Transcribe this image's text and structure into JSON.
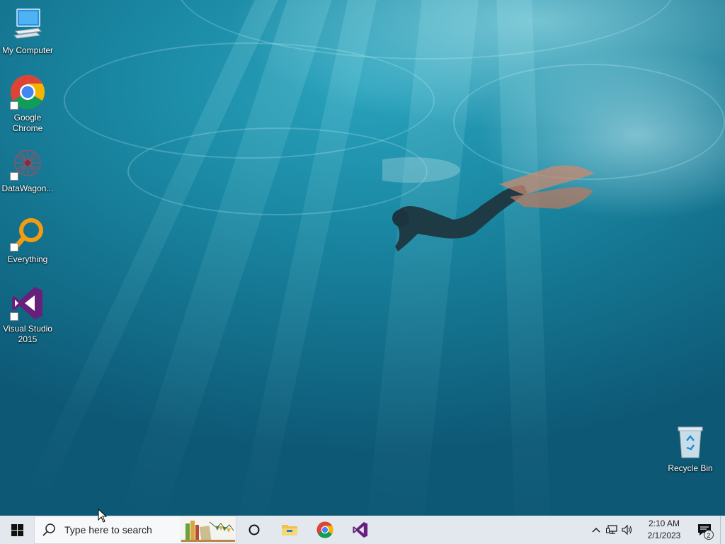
{
  "desktop": {
    "icons": [
      {
        "label": "My Computer"
      },
      {
        "label": "Google Chrome"
      },
      {
        "label": "DataWagon..."
      },
      {
        "label": "Everything"
      },
      {
        "label": "Visual Studio 2015"
      },
      {
        "label": "Recycle Bin"
      }
    ]
  },
  "taskbar": {
    "start_icon": "windows-logo-icon",
    "search": {
      "placeholder": "Type here to search"
    },
    "pinned_apps": [
      "cortana-icon",
      "file-explorer-icon",
      "chrome-icon",
      "visual-studio-icon"
    ],
    "tray": {
      "icons": [
        "chevron-up-icon",
        "network-icon",
        "volume-icon"
      ],
      "time": "2:10 AM",
      "date": "2/1/2023",
      "notification_count": "2"
    }
  },
  "colors": {
    "taskbar_bg": "#e2e8ee",
    "water": "#136f8b",
    "chrome_red": "#db4437",
    "chrome_green": "#0f9d58",
    "chrome_yellow": "#f4b400",
    "chrome_blue": "#4285f4",
    "visual_studio_purple": "#68217a",
    "everything_orange": "#f39c12"
  }
}
